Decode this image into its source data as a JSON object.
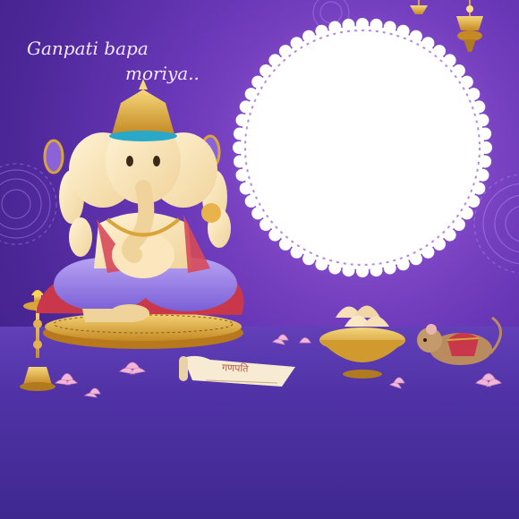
{
  "greeting": {
    "line1": "Ganpati bapa",
    "line2": "moriya.."
  },
  "scroll_text": "गणपति",
  "icons": [
    "ganesha-idol-icon",
    "oil-lamp-icon",
    "modak-bowl-icon",
    "mouse-icon",
    "lotus-icon",
    "hanging-lamp-icon",
    "mandala-icon"
  ],
  "colors": {
    "background": "#5a30a8",
    "frame": "#ffffff",
    "gold": "#d9a43a",
    "lotus": "#f2b6d8"
  }
}
